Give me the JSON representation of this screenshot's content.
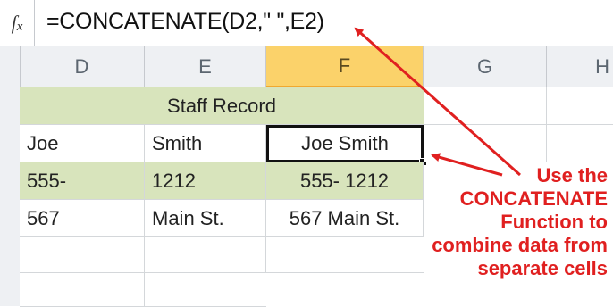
{
  "formula_bar": {
    "fx_icon": "fx-icon",
    "formula": "=CONCATENATE(D2,\" \",E2)"
  },
  "columns": [
    "D",
    "E",
    "F",
    "G",
    "H"
  ],
  "selected_column": "F",
  "table": {
    "title": "Staff Record",
    "rows": [
      [
        "Joe",
        "Smith",
        "Joe Smith"
      ],
      [
        "555-",
        "1212",
        "555- 1212"
      ],
      [
        "567",
        "Main St.",
        "567 Main St."
      ]
    ]
  },
  "callout_lines": [
    "Use the",
    "CONCATENATE",
    "Function to",
    "combine data from",
    "separate cells"
  ],
  "colors": {
    "band_green": "#d8e4bc",
    "selected_header": "#fbd26a",
    "annotation_red": "#e02020"
  }
}
